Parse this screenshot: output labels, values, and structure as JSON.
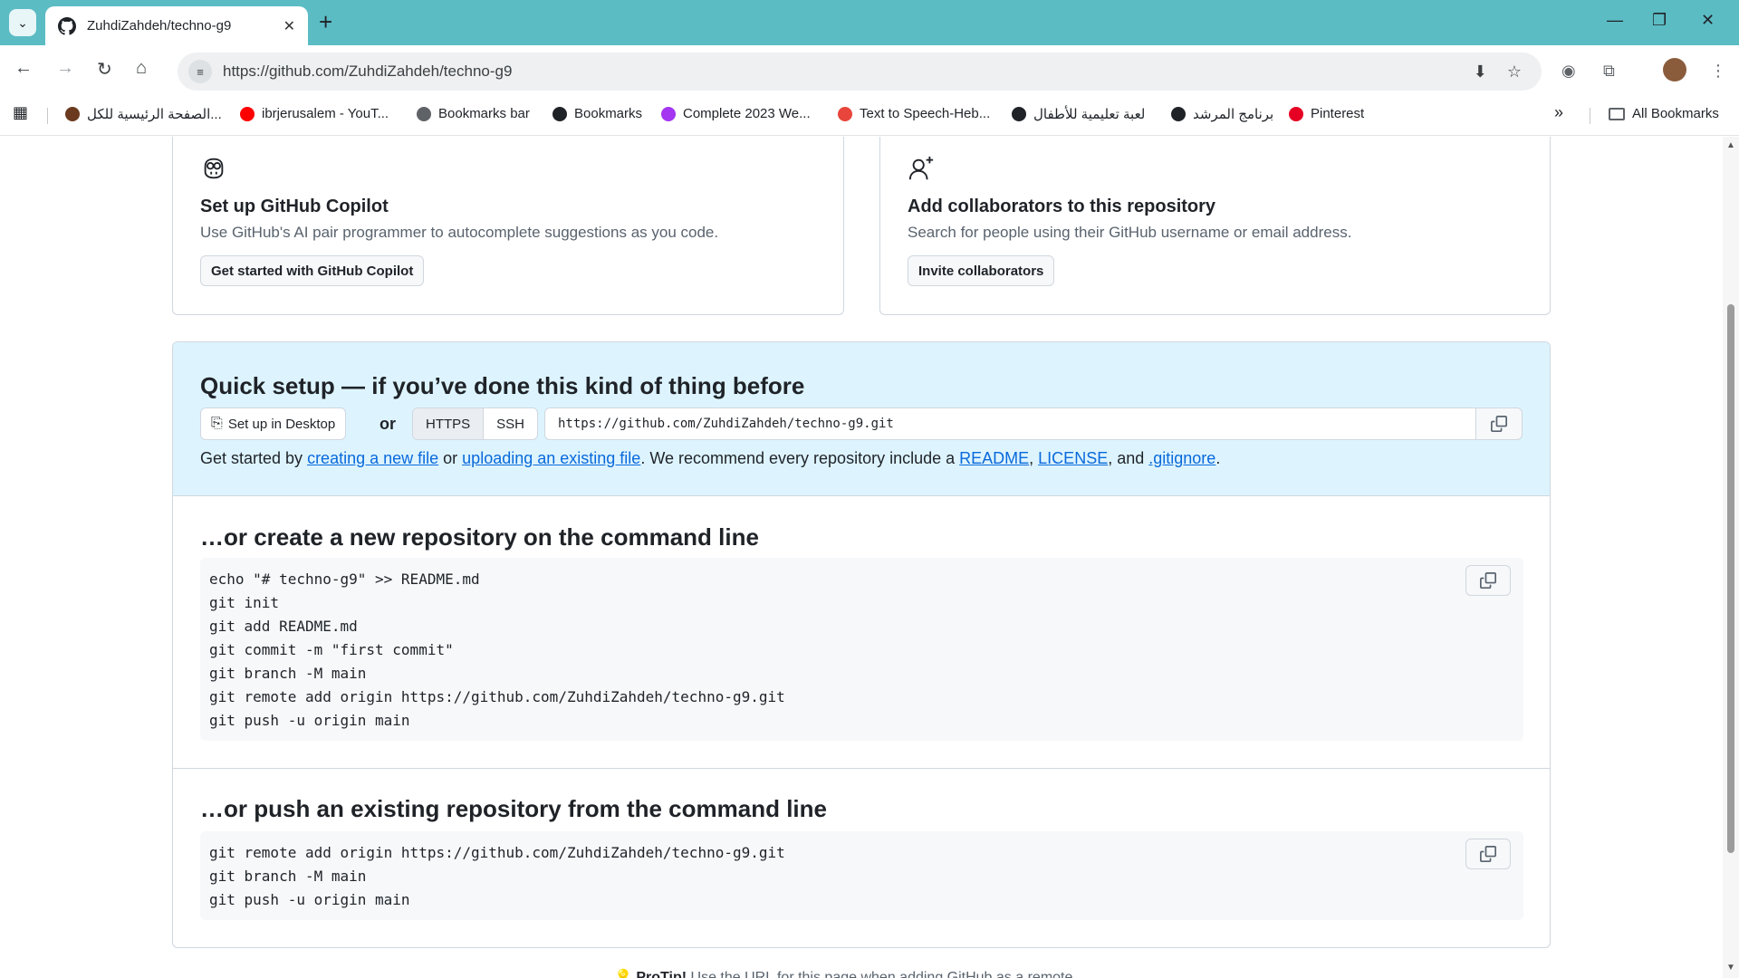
{
  "browser": {
    "tab_title": "ZuhdiZahdeh/techno-g9",
    "url": "https://github.com/ZuhdiZahdeh/techno-g9",
    "new_tab": "+",
    "tab_close": "✕",
    "win_minimize": "—",
    "win_restore": "❐",
    "win_close": "✕",
    "bookmarks": [
      {
        "label": "الصفحة الرئيسية للكل...",
        "icon": "globe-icon",
        "color": "#6b3a1e"
      },
      {
        "label": "ibrjerusalem - YouT...",
        "icon": "youtube-icon",
        "color": "#ff0000"
      },
      {
        "label": "Bookmarks bar",
        "icon": "folder-icon",
        "color": "#5f6368"
      },
      {
        "label": "Bookmarks",
        "icon": "star-icon",
        "color": "#1f2328"
      },
      {
        "label": "Complete 2023 We...",
        "icon": "udemy-icon",
        "color": "#a435f0"
      },
      {
        "label": "Text to Speech-Heb...",
        "icon": "speech-icon",
        "color": "#e8453c"
      },
      {
        "label": "لعبة تعليمية للأطفال",
        "icon": "globe-icon",
        "color": "#1f2328"
      },
      {
        "label": "برنامج المرشد",
        "icon": "globe-icon",
        "color": "#1f2328"
      },
      {
        "label": "Pinterest",
        "icon": "pinterest-icon",
        "color": "#e60023"
      }
    ],
    "more_bookmarks": "»",
    "all_bookmarks": "All Bookmarks"
  },
  "cards": {
    "copilot": {
      "title": "Set up GitHub Copilot",
      "desc": "Use GitHub's AI pair programmer to autocomplete suggestions as you code.",
      "button": "Get started with GitHub Copilot"
    },
    "collab": {
      "title": "Add collaborators to this repository",
      "desc": "Search for people using their GitHub username or email address.",
      "button": "Invite collaborators"
    }
  },
  "quick_setup": {
    "title": "Quick setup — if you’ve done this kind of thing before",
    "desktop_button": "Set up in Desktop",
    "or": "or",
    "protocols": [
      "HTTPS",
      "SSH"
    ],
    "selected_protocol": "HTTPS",
    "clone_url": "https://github.com/ZuhdiZahdeh/techno-g9.git",
    "gs_prefix": "Get started by ",
    "link_new_file": "creating a new file",
    "gs_or": " or ",
    "link_upload": "uploading an existing file",
    "gs_mid": ". We recommend every repository include a ",
    "link_readme": "README",
    "comma1": ", ",
    "link_license": "LICENSE",
    "gs_and": ", and ",
    "link_gitignore": ".gitignore",
    "period": "."
  },
  "create_section": {
    "title": "…or create a new repository on the command line",
    "lines": [
      "echo \"# techno-g9\" >> README.md",
      "git init",
      "git add README.md",
      "git commit -m \"first commit\"",
      "git branch -M main",
      "git remote add origin https://github.com/ZuhdiZahdeh/techno-g9.git",
      "git push -u origin main"
    ]
  },
  "push_section": {
    "title": "…or push an existing repository from the command line",
    "lines": [
      "git remote add origin https://github.com/ZuhdiZahdeh/techno-g9.git",
      "git branch -M main",
      "git push -u origin main"
    ]
  },
  "protip": {
    "label": "ProTip!",
    "text": " Use the URL for this page when adding GitHub as a remote."
  }
}
